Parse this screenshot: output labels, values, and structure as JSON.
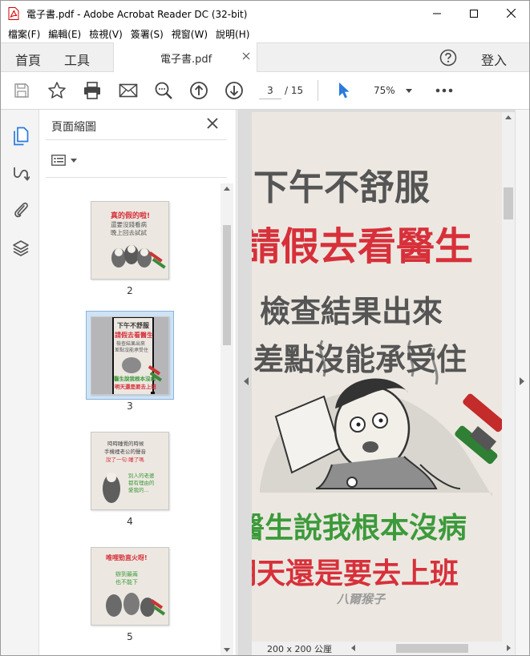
{
  "window": {
    "title": "電子書.pdf - Adobe Acrobat Reader DC (32-bit)"
  },
  "menu": [
    "檔案(F)",
    "編輯(E)",
    "檢視(V)",
    "簽署(S)",
    "視窗(W)",
    "說明(H)"
  ],
  "tabs": {
    "home": "首頁",
    "tools": "工具",
    "document": "電子書.pdf",
    "signin": "登入"
  },
  "toolbar": {
    "current_page": "3",
    "total_pages": "/ 15",
    "zoom": "75%"
  },
  "thumbnails_panel": {
    "title": "頁面縮圖",
    "pages": [
      {
        "label": "2",
        "text_lines": [
          "真的假的啦!",
          "還要沒錢看病",
          "晚上回去試試"
        ]
      },
      {
        "label": "3",
        "selected": true,
        "text_lines": [
          "下午不舒服",
          "請假去看醫生",
          "檢查結果出來",
          "差點沒能承受住",
          "醫生說我根本沒病",
          "明天還是要去上班"
        ]
      },
      {
        "label": "4",
        "text_lines": [
          "時時睡覺的時候",
          "手機裡老公的聲音",
          "說了一句:睡了嗎",
          "別人的老婆",
          "都有理由的",
          "愛我的..."
        ]
      },
      {
        "label": "5",
        "text_lines": [
          "唯哩勁直火呀!",
          "辦到最兩",
          "也不能下"
        ]
      }
    ]
  },
  "page": {
    "lines": [
      "下午不舒服",
      "請假去看醫生",
      "檢查結果出來",
      "差點沒能承受住",
      "醫生說我根本沒病",
      "明天還是要去上班"
    ],
    "watermark": "八爾猴子",
    "dimensions": "200 x 200 公厘"
  },
  "colors": {
    "accent_blue": "#2b7bdc",
    "page_red": "#d7303a",
    "page_green": "#3c9a3a",
    "page_gray_text": "#555555"
  }
}
